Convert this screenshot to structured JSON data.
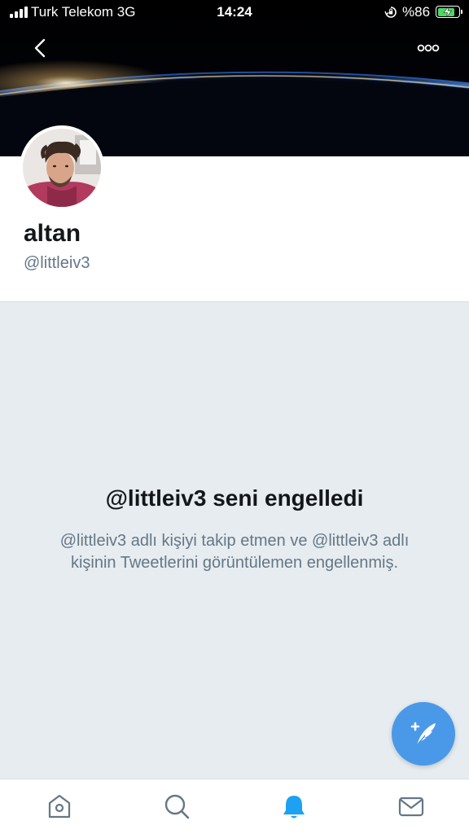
{
  "status_bar": {
    "carrier": "Turk Telekom 3G",
    "time": "14:24",
    "battery_percent": "%86",
    "battery_level": 0.86,
    "battery_color": "#4cd964",
    "orientation_icon": "orientation-lock-icon",
    "charging_icon": "bolt-icon"
  },
  "header": {
    "back_icon": "chevron-left-icon",
    "more_icon": "more-horizontal-icon"
  },
  "profile": {
    "name": "altan",
    "handle": "@littleiv3"
  },
  "blocked": {
    "title": "@littleiv3 seni engelledi",
    "message": "@littleiv3 adlı kişiyi takip etmen ve @littleiv3 adlı kişinin Tweetlerini görüntülemen engellenmiş."
  },
  "fab": {
    "icon": "compose-tweet-icon",
    "color": "#4a99e9"
  },
  "tabs": [
    {
      "icon": "home-icon",
      "active": false
    },
    {
      "icon": "search-icon",
      "active": false
    },
    {
      "icon": "notifications-icon",
      "active": true
    },
    {
      "icon": "messages-icon",
      "active": false
    }
  ],
  "colors": {
    "accent": "#1da1f2",
    "secondary_text": "#657786",
    "panel_bg": "#e6ecf0"
  }
}
